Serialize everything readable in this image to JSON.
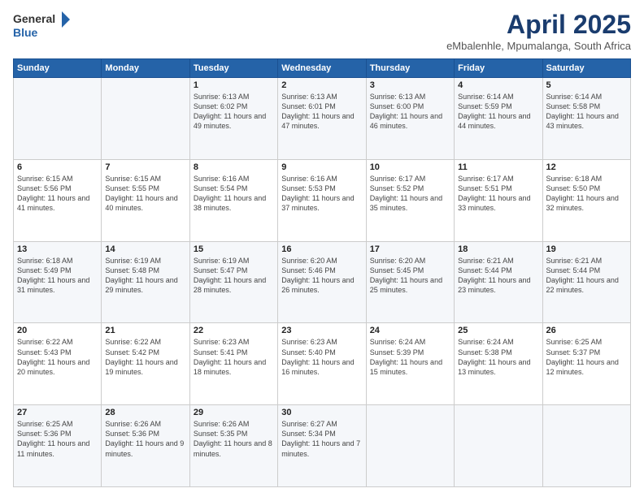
{
  "header": {
    "logo_general": "General",
    "logo_blue": "Blue",
    "month": "April 2025",
    "location": "eMbalenhle, Mpumalanga, South Africa"
  },
  "days_of_week": [
    "Sunday",
    "Monday",
    "Tuesday",
    "Wednesday",
    "Thursday",
    "Friday",
    "Saturday"
  ],
  "weeks": [
    [
      {
        "day": "",
        "info": ""
      },
      {
        "day": "",
        "info": ""
      },
      {
        "day": "1",
        "info": "Sunrise: 6:13 AM\nSunset: 6:02 PM\nDaylight: 11 hours and 49 minutes."
      },
      {
        "day": "2",
        "info": "Sunrise: 6:13 AM\nSunset: 6:01 PM\nDaylight: 11 hours and 47 minutes."
      },
      {
        "day": "3",
        "info": "Sunrise: 6:13 AM\nSunset: 6:00 PM\nDaylight: 11 hours and 46 minutes."
      },
      {
        "day": "4",
        "info": "Sunrise: 6:14 AM\nSunset: 5:59 PM\nDaylight: 11 hours and 44 minutes."
      },
      {
        "day": "5",
        "info": "Sunrise: 6:14 AM\nSunset: 5:58 PM\nDaylight: 11 hours and 43 minutes."
      }
    ],
    [
      {
        "day": "6",
        "info": "Sunrise: 6:15 AM\nSunset: 5:56 PM\nDaylight: 11 hours and 41 minutes."
      },
      {
        "day": "7",
        "info": "Sunrise: 6:15 AM\nSunset: 5:55 PM\nDaylight: 11 hours and 40 minutes."
      },
      {
        "day": "8",
        "info": "Sunrise: 6:16 AM\nSunset: 5:54 PM\nDaylight: 11 hours and 38 minutes."
      },
      {
        "day": "9",
        "info": "Sunrise: 6:16 AM\nSunset: 5:53 PM\nDaylight: 11 hours and 37 minutes."
      },
      {
        "day": "10",
        "info": "Sunrise: 6:17 AM\nSunset: 5:52 PM\nDaylight: 11 hours and 35 minutes."
      },
      {
        "day": "11",
        "info": "Sunrise: 6:17 AM\nSunset: 5:51 PM\nDaylight: 11 hours and 33 minutes."
      },
      {
        "day": "12",
        "info": "Sunrise: 6:18 AM\nSunset: 5:50 PM\nDaylight: 11 hours and 32 minutes."
      }
    ],
    [
      {
        "day": "13",
        "info": "Sunrise: 6:18 AM\nSunset: 5:49 PM\nDaylight: 11 hours and 31 minutes."
      },
      {
        "day": "14",
        "info": "Sunrise: 6:19 AM\nSunset: 5:48 PM\nDaylight: 11 hours and 29 minutes."
      },
      {
        "day": "15",
        "info": "Sunrise: 6:19 AM\nSunset: 5:47 PM\nDaylight: 11 hours and 28 minutes."
      },
      {
        "day": "16",
        "info": "Sunrise: 6:20 AM\nSunset: 5:46 PM\nDaylight: 11 hours and 26 minutes."
      },
      {
        "day": "17",
        "info": "Sunrise: 6:20 AM\nSunset: 5:45 PM\nDaylight: 11 hours and 25 minutes."
      },
      {
        "day": "18",
        "info": "Sunrise: 6:21 AM\nSunset: 5:44 PM\nDaylight: 11 hours and 23 minutes."
      },
      {
        "day": "19",
        "info": "Sunrise: 6:21 AM\nSunset: 5:44 PM\nDaylight: 11 hours and 22 minutes."
      }
    ],
    [
      {
        "day": "20",
        "info": "Sunrise: 6:22 AM\nSunset: 5:43 PM\nDaylight: 11 hours and 20 minutes."
      },
      {
        "day": "21",
        "info": "Sunrise: 6:22 AM\nSunset: 5:42 PM\nDaylight: 11 hours and 19 minutes."
      },
      {
        "day": "22",
        "info": "Sunrise: 6:23 AM\nSunset: 5:41 PM\nDaylight: 11 hours and 18 minutes."
      },
      {
        "day": "23",
        "info": "Sunrise: 6:23 AM\nSunset: 5:40 PM\nDaylight: 11 hours and 16 minutes."
      },
      {
        "day": "24",
        "info": "Sunrise: 6:24 AM\nSunset: 5:39 PM\nDaylight: 11 hours and 15 minutes."
      },
      {
        "day": "25",
        "info": "Sunrise: 6:24 AM\nSunset: 5:38 PM\nDaylight: 11 hours and 13 minutes."
      },
      {
        "day": "26",
        "info": "Sunrise: 6:25 AM\nSunset: 5:37 PM\nDaylight: 11 hours and 12 minutes."
      }
    ],
    [
      {
        "day": "27",
        "info": "Sunrise: 6:25 AM\nSunset: 5:36 PM\nDaylight: 11 hours and 11 minutes."
      },
      {
        "day": "28",
        "info": "Sunrise: 6:26 AM\nSunset: 5:36 PM\nDaylight: 11 hours and 9 minutes."
      },
      {
        "day": "29",
        "info": "Sunrise: 6:26 AM\nSunset: 5:35 PM\nDaylight: 11 hours and 8 minutes."
      },
      {
        "day": "30",
        "info": "Sunrise: 6:27 AM\nSunset: 5:34 PM\nDaylight: 11 hours and 7 minutes."
      },
      {
        "day": "",
        "info": ""
      },
      {
        "day": "",
        "info": ""
      },
      {
        "day": "",
        "info": ""
      }
    ]
  ]
}
